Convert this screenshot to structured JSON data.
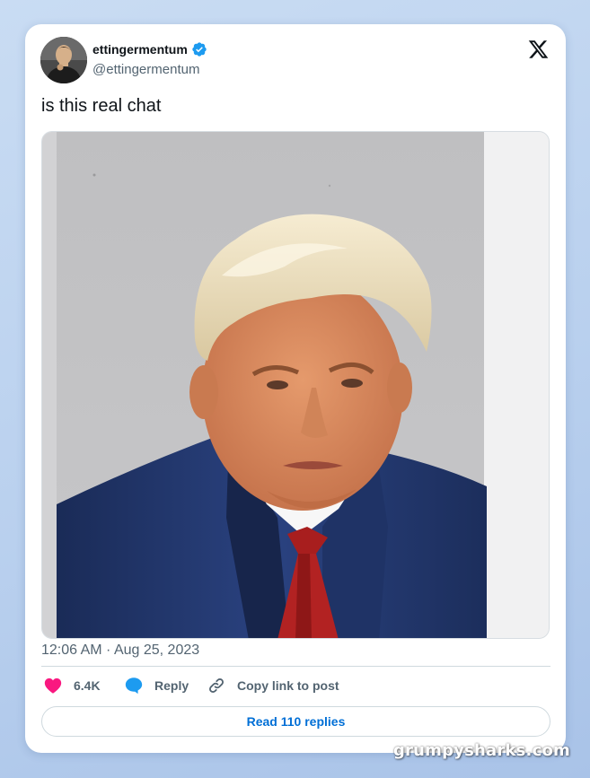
{
  "post": {
    "display_name": "ettingermentum",
    "handle": "@ettingermentum",
    "text": "is this real chat",
    "timestamp": "12:06 AM · Aug 25, 2023",
    "verified": true
  },
  "actions": {
    "like_count": "6.4K",
    "reply_label": "Reply",
    "copy_link_label": "Copy link to post"
  },
  "read_replies_label": "Read 110 replies",
  "watermark": "grumpysharks.com",
  "icons": {
    "brand": "x-logo-icon",
    "verified": "verified-badge-icon",
    "like": "heart-icon",
    "reply": "speech-bubble-icon",
    "copy_link": "link-icon"
  },
  "colors": {
    "like": "#f91880",
    "reply": "#1d9bf0",
    "verified": "#1d9bf0",
    "link_text": "#006fd6",
    "secondary_text": "#536471"
  }
}
